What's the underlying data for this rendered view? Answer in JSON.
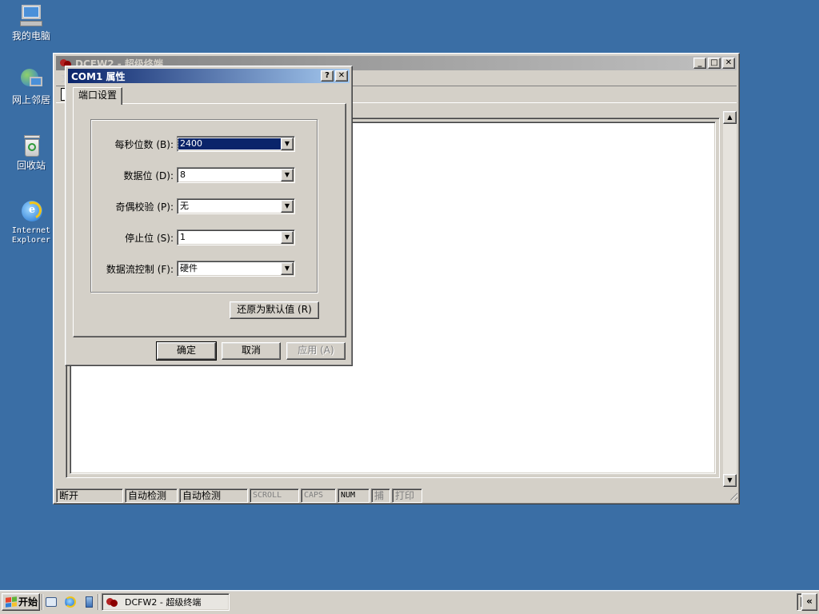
{
  "desktop": {
    "icons": [
      {
        "label": "我的电脑",
        "icon": "my-computer-icon"
      },
      {
        "label": "网上邻居",
        "icon": "network-places-icon"
      },
      {
        "label": "回收站",
        "icon": "recycle-bin-icon"
      },
      {
        "label": "Internet Explorer",
        "icon": "internet-explorer-icon"
      }
    ]
  },
  "main_window": {
    "title": "DCFW2 - 超级终端",
    "menu_first": "文",
    "controls": {
      "minimize": "_",
      "maximize": "□",
      "close": "✕"
    },
    "statusbar": {
      "connection": "断开",
      "detect1": "自动检测",
      "detect2": "自动检测",
      "scroll": "SCROLL",
      "caps": "CAPS",
      "num": "NUM",
      "capture": "捕",
      "print": "打印"
    }
  },
  "dialog": {
    "title": "COM1 属性",
    "help": "?",
    "close": "✕",
    "tab": "端口设置",
    "fields": [
      {
        "label": "每秒位数 (B):",
        "value": "2400"
      },
      {
        "label": "数据位 (D):",
        "value": "8"
      },
      {
        "label": "奇偶校验 (P):",
        "value": "无"
      },
      {
        "label": "停止位 (S):",
        "value": "1"
      },
      {
        "label": "数据流控制 (F):",
        "value": "硬件"
      }
    ],
    "restore_defaults": "还原为默认值 (R)",
    "ok": "确定",
    "cancel": "取消",
    "apply": "应用 (A)"
  },
  "taskbar": {
    "start": "开始",
    "task_title": "DCFW2 - 超级终端",
    "tray_expand": "«"
  },
  "colors": {
    "desktop": "#3a6ea5",
    "active_title_start": "#0a246a",
    "active_title_end": "#a6caf0",
    "face": "#d4d0c8"
  }
}
